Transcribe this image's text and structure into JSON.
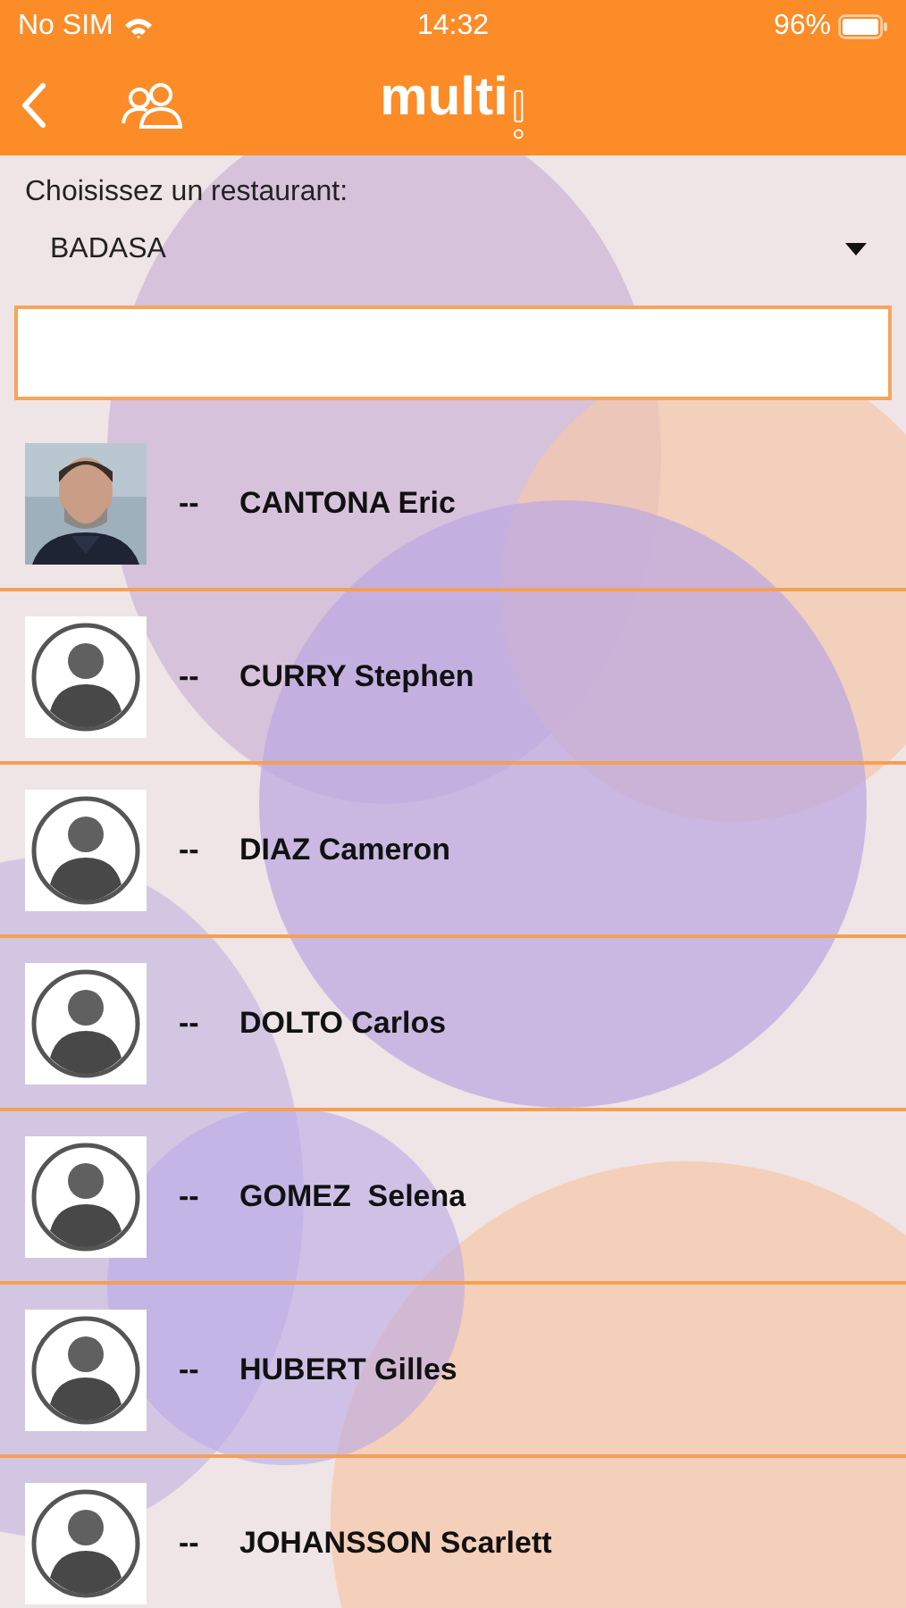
{
  "status_bar": {
    "carrier": "No SIM",
    "time": "14:32",
    "battery": "96%"
  },
  "header": {
    "logo": "multi"
  },
  "restaurant_picker": {
    "label": "Choisissez un restaurant:",
    "value": "BADASA"
  },
  "people": [
    {
      "separator": "--",
      "name": "CANTONA Eric"
    },
    {
      "kind": "default",
      "separator": "--",
      "name": "CURRY Stephen"
    },
    {
      "kind": "default",
      "separator": "--",
      "name": "DIAZ Cameron"
    },
    {
      "kind": "default",
      "separator": "--",
      "name": "DOLTO Carlos"
    },
    {
      "kind": "default",
      "separator": "--",
      "name": "GOMEZ  Selena"
    },
    {
      "kind": "default",
      "separator": "--",
      "name": "HUBERT Gilles"
    },
    {
      "kind": "default",
      "separator": "--",
      "name": "JOHANSSON Scarlett"
    }
  ]
}
